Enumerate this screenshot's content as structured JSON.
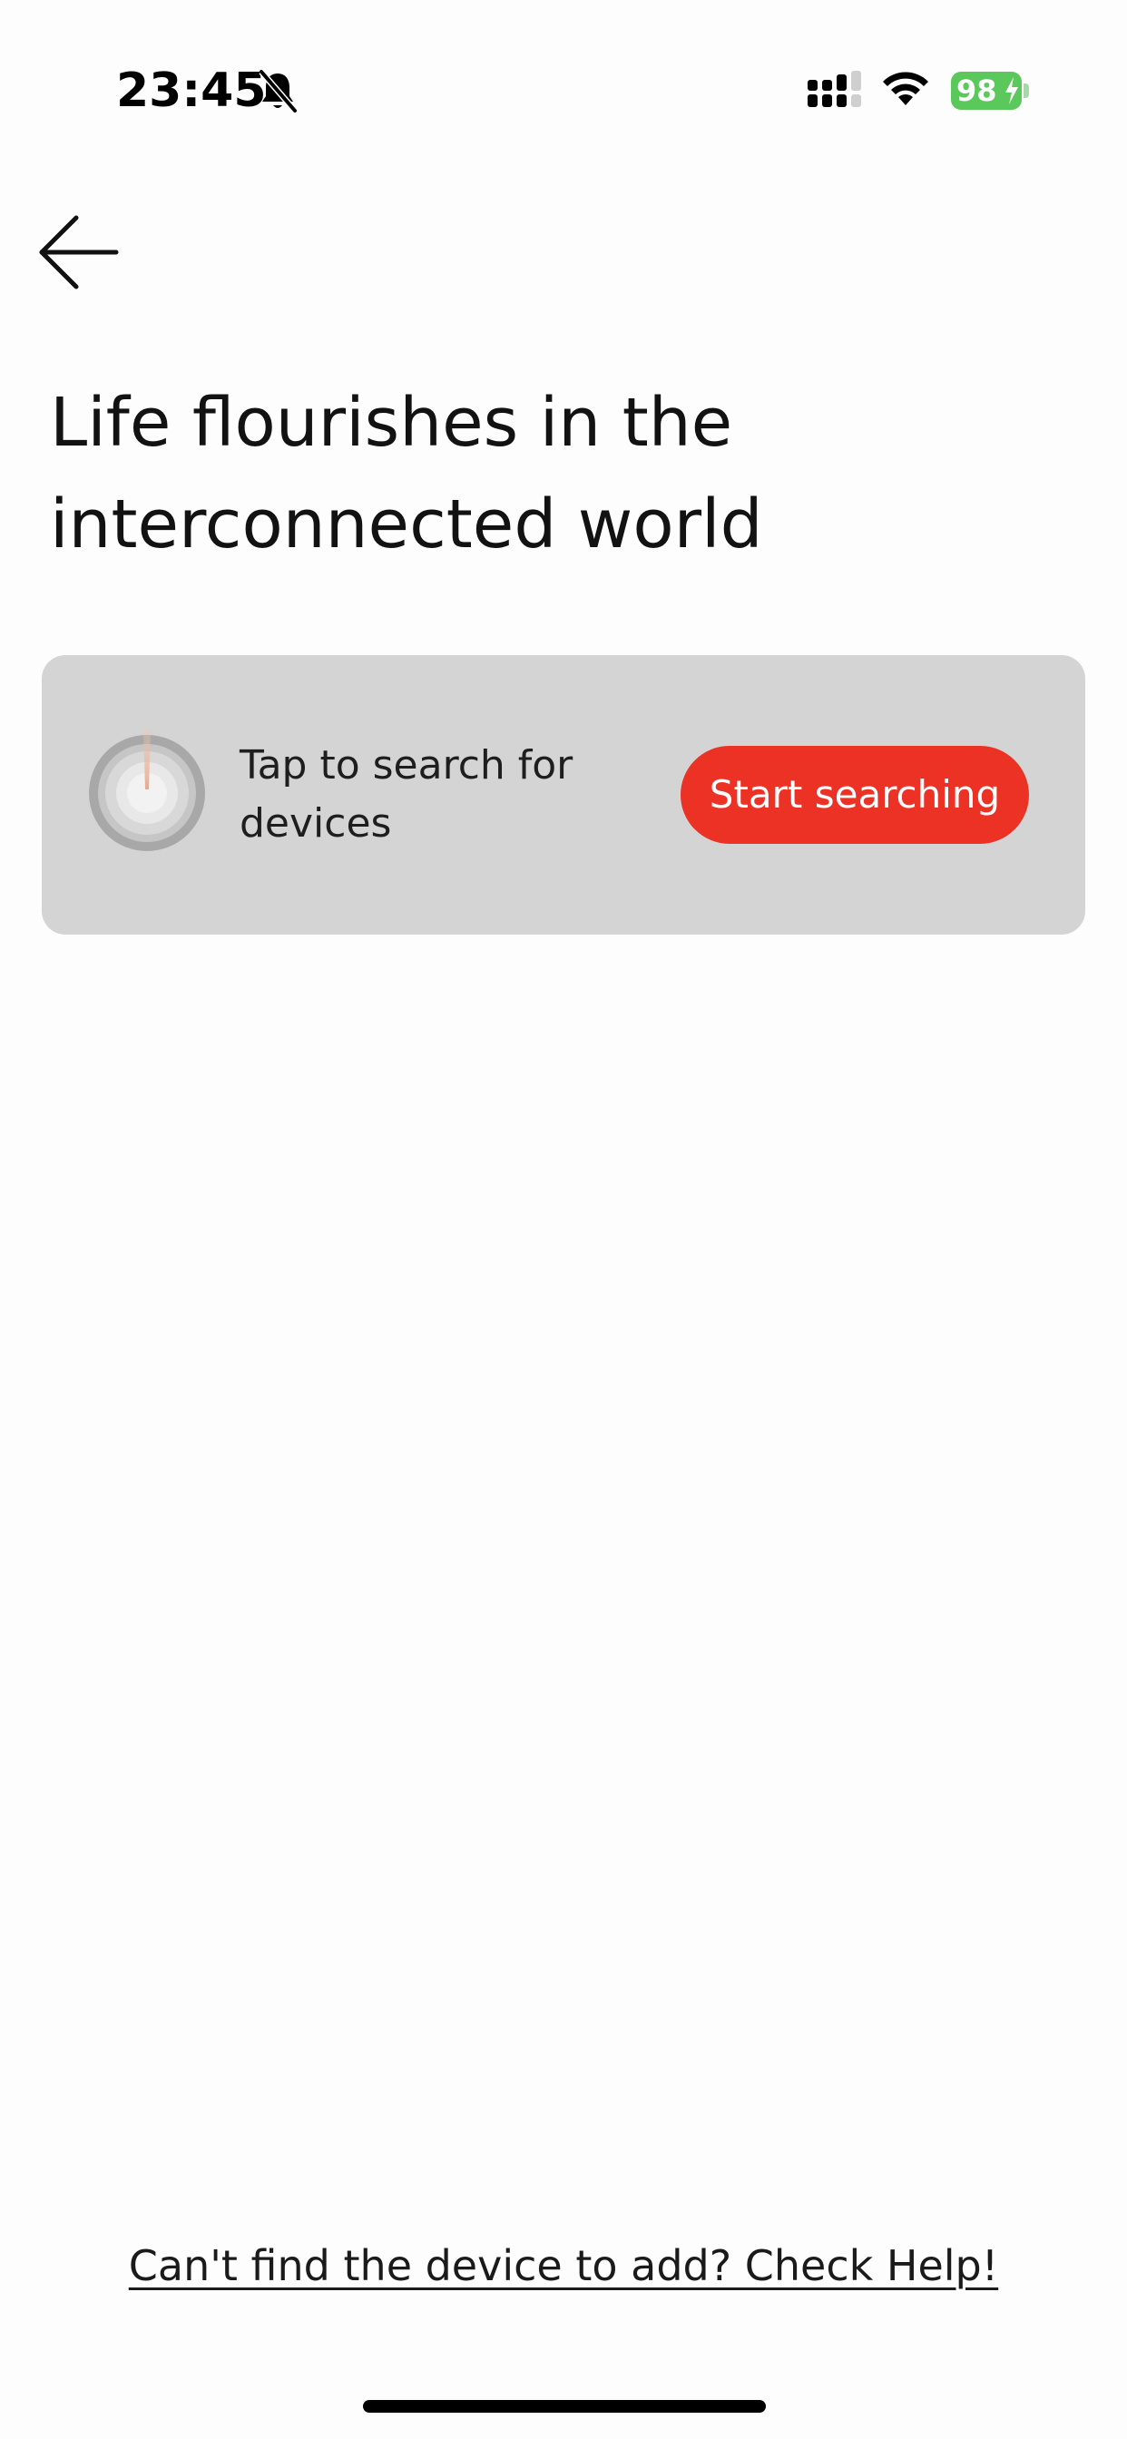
{
  "status_bar": {
    "time": "23:45",
    "battery": "98",
    "icons": [
      "bell-slash-icon",
      "signal-icon",
      "wifi-icon",
      "battery-charging-icon"
    ]
  },
  "header": {
    "back_icon": "arrow-left-icon"
  },
  "headline": {
    "line1": "Life flourishes in the",
    "line2": "interconnected world"
  },
  "search_card": {
    "icon": "radar-icon",
    "text_line1": "Tap to search for",
    "text_line2": "devices",
    "button_label": "Start searching"
  },
  "help": {
    "link_text": "Can't find the device to add? Check Help!"
  },
  "colors": {
    "accent": "#ec3225",
    "card_bg": "#d4d4d4",
    "battery": "#5ac85a"
  }
}
